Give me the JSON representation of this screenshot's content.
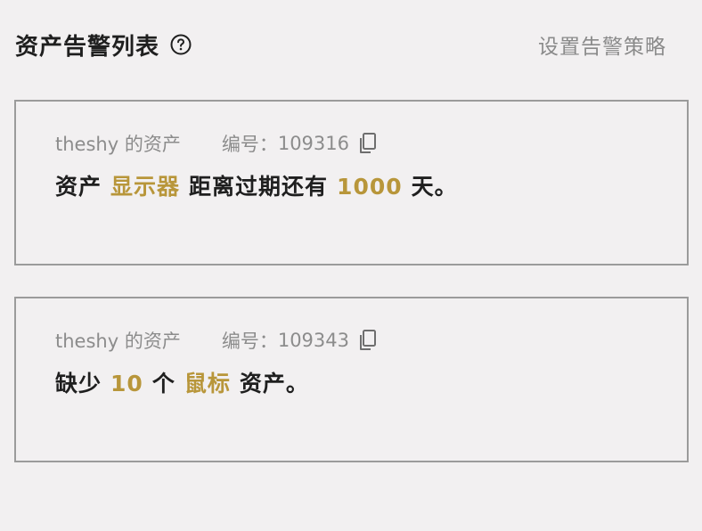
{
  "header": {
    "title": "资产告警列表",
    "policy_link": "设置告警策略"
  },
  "colors": {
    "background": "#f2f0f1",
    "highlight": "#b8963a",
    "border": "#9b9b9b",
    "text_primary": "#1f1f1f",
    "text_secondary": "#8c8c8c"
  },
  "alerts": [
    {
      "owner": "theshy 的资产",
      "id_label": "编号：",
      "id_value": "109316",
      "message": {
        "p1": "资产",
        "asset": "显示器",
        "p2": "距离过期还有",
        "days": "1000",
        "p3": "天。"
      }
    },
    {
      "owner": "theshy 的资产",
      "id_label": "编号：",
      "id_value": "109343",
      "message": {
        "p1": "缺少",
        "count": "10",
        "p2": "个",
        "asset": "鼠标",
        "p3": "资产。"
      }
    }
  ]
}
